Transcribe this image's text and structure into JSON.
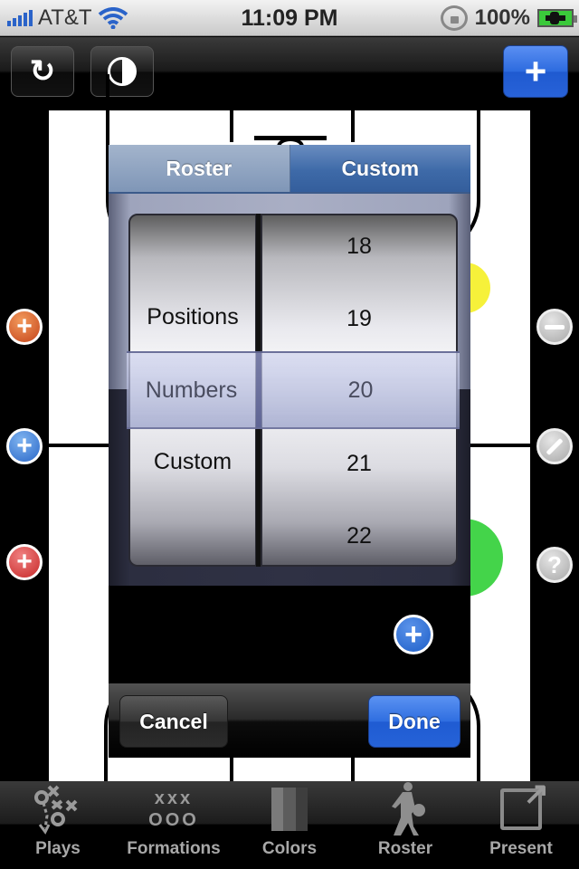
{
  "status_bar": {
    "carrier": "AT&T",
    "time": "11:09 PM",
    "battery_percent": "100%",
    "icons": [
      "signal-icon",
      "wifi-icon",
      "rotation-lock-icon",
      "battery-charging-icon"
    ]
  },
  "top_toolbar": {
    "buttons": [
      {
        "name": "refresh-button",
        "icon": "refresh-icon",
        "glyph": "↻"
      },
      {
        "name": "contrast-button",
        "icon": "contrast-icon"
      },
      {
        "name": "add-button",
        "icon": "plus-icon",
        "glyph": "+"
      }
    ]
  },
  "court": {
    "players": [
      {
        "color": "#f6f13a",
        "label": ""
      },
      {
        "color": "#44d44a",
        "label": ""
      }
    ]
  },
  "side_buttons": {
    "left": [
      {
        "name": "add-orange-player-button",
        "color": "#d8602a",
        "glyph": "+"
      },
      {
        "name": "add-blue-player-button",
        "color": "#3a78d4",
        "glyph": "+"
      },
      {
        "name": "add-red-player-button",
        "color": "#d63c3c",
        "glyph": "+"
      }
    ],
    "right": [
      {
        "name": "remove-button",
        "icon": "minus-icon"
      },
      {
        "name": "draw-button",
        "icon": "pencil-icon"
      },
      {
        "name": "help-button",
        "icon": "question-icon",
        "glyph": "?"
      }
    ]
  },
  "popover": {
    "segments": [
      {
        "label": "Roster",
        "selected": false
      },
      {
        "label": "Custom",
        "selected": true
      }
    ],
    "picker": {
      "left_column": {
        "rows": [
          "Positions",
          "Numbers",
          "Custom"
        ],
        "selected": "Numbers"
      },
      "right_column": {
        "rows": [
          "18",
          "19",
          "20",
          "21",
          "22"
        ],
        "selected": "20"
      }
    },
    "add_glyph": "+",
    "cancel_label": "Cancel",
    "done_label": "Done"
  },
  "tab_bar": {
    "tabs": [
      {
        "label": "Plays",
        "icon": "plays-icon"
      },
      {
        "label": "Formations",
        "icon": "formations-icon",
        "glyph_top": "xxx",
        "glyph_bottom": "OOO"
      },
      {
        "label": "Colors",
        "icon": "colors-icon"
      },
      {
        "label": "Roster",
        "icon": "player-silhouette-icon"
      },
      {
        "label": "Present",
        "icon": "present-icon"
      }
    ]
  }
}
